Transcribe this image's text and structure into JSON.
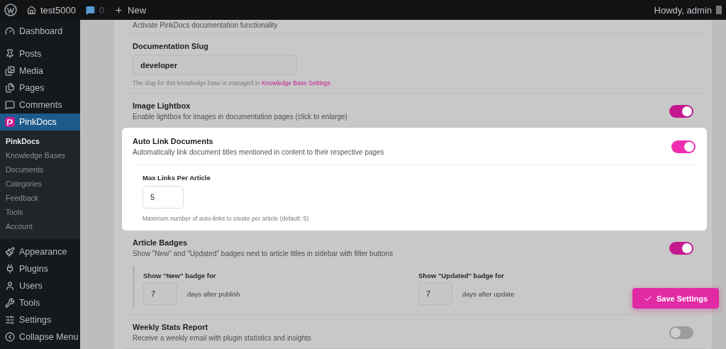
{
  "admin_bar": {
    "site": "test5000",
    "comments": "0",
    "new": "New",
    "greeting": "Howdy, admin"
  },
  "sidebar": {
    "items": [
      {
        "label": "Dashboard",
        "selected": false
      },
      {
        "label": "Posts",
        "selected": false
      },
      {
        "label": "Media",
        "selected": false
      },
      {
        "label": "Pages",
        "selected": false
      },
      {
        "label": "Comments",
        "selected": false
      },
      {
        "label": "PinkDocs",
        "selected": true,
        "children": [
          {
            "label": "PinkDocs",
            "selected": true
          },
          {
            "label": "Knowledge Bases",
            "selected": false
          },
          {
            "label": "Documents",
            "selected": false
          },
          {
            "label": "Categories",
            "selected": false
          },
          {
            "label": "Feedback",
            "selected": false
          },
          {
            "label": "Tools",
            "selected": false
          },
          {
            "label": "Account",
            "selected": false
          }
        ]
      },
      {
        "label": "Appearance",
        "selected": false
      },
      {
        "label": "Plugins",
        "selected": false
      },
      {
        "label": "Users",
        "selected": false
      },
      {
        "label": "Tools",
        "selected": false
      },
      {
        "label": "Settings",
        "selected": false
      },
      {
        "label": "Collapse Menu",
        "selected": false
      }
    ]
  },
  "settings": [
    {
      "kind": "note",
      "description": "Activate PinkDocs documentation functionality"
    },
    {
      "kind": "text",
      "label": "Documentation Slug",
      "value": "developer",
      "help": "The slug for this knowledge base is managed in",
      "help_link": "Knowledge Base Settings",
      "help_end": "."
    },
    {
      "kind": "toggle",
      "label": "Image Lightbox",
      "description": "Enable lightbox for images in documentation pages (click to enlarge)",
      "on": true,
      "highlighted": false
    },
    {
      "kind": "toggle",
      "label": "Auto Link Documents",
      "description": "Automatically link document titles mentioned in content to their respective pages",
      "on": true,
      "highlighted": true,
      "fields": [
        {
          "label": "Max Links Per Article",
          "value": "5"
        }
      ],
      "note": "Maximum number of auto-links to create per article (default: 5)"
    },
    {
      "kind": "toggle",
      "label": "Article Badges",
      "description": "Show \"New\" and \"Updated\" badges next to article titles in sidebar with filter buttons",
      "on": true,
      "highlighted": false,
      "bordered": true,
      "fields": [
        {
          "label": "Show \"New\" badge for",
          "value": "7",
          "suffix": "days after publish"
        },
        {
          "label": "Show \"Updated\" badge for",
          "value": "7",
          "suffix": "days after update"
        }
      ]
    },
    {
      "kind": "toggle",
      "label": "Weekly Stats Report",
      "description": "Receive a weekly email with plugin statistics and insights",
      "on": false,
      "highlighted": false
    }
  ],
  "save_button": {
    "label": "Save Settings"
  }
}
